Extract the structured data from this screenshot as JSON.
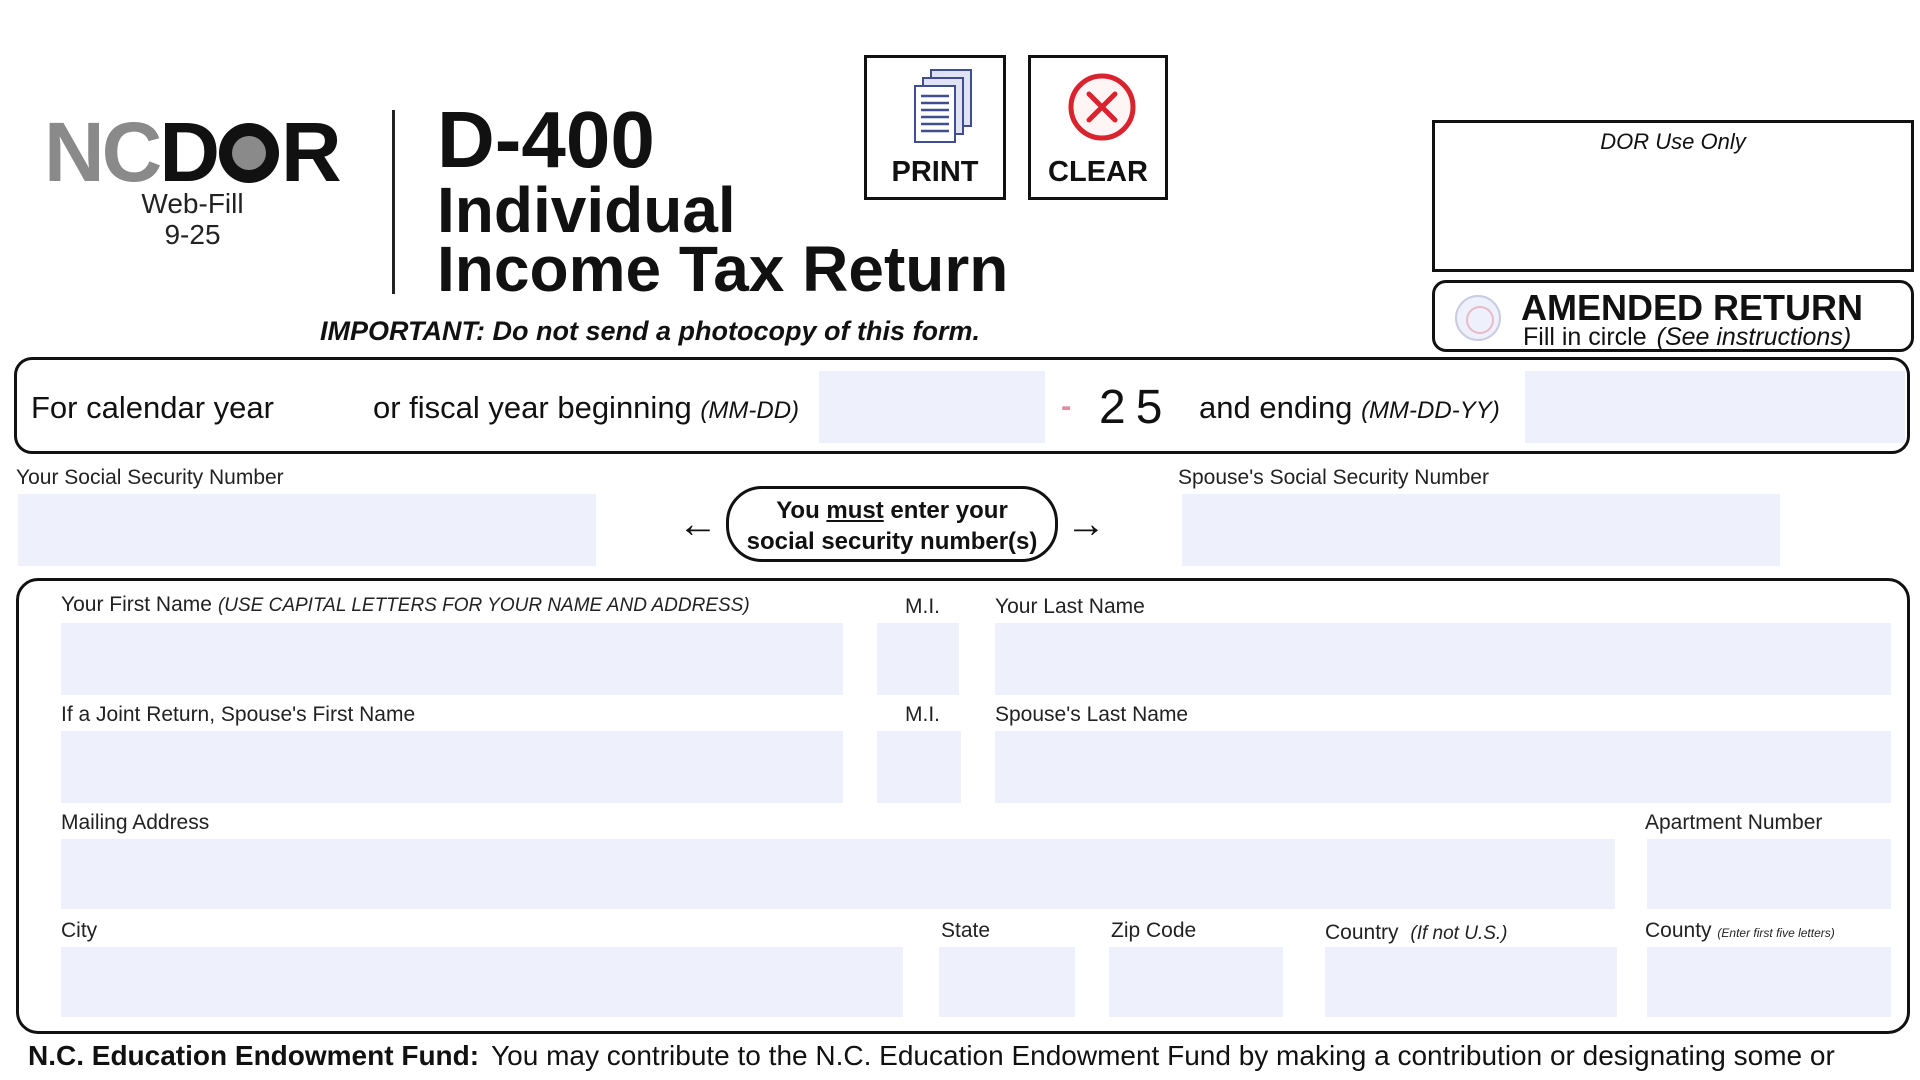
{
  "header": {
    "logo_nc": "NC",
    "logo_d": "D",
    "logo_r": "R",
    "webfill": "Web-Fill",
    "version": "9-25",
    "form_number": "D-400",
    "title_line1": "Individual",
    "title_line2": "Income Tax Return",
    "important": "IMPORTANT:  Do not send a photocopy of this form."
  },
  "buttons": {
    "print_label": "PRINT",
    "clear_label": "CLEAR"
  },
  "dor_box": {
    "label": "DOR Use Only"
  },
  "amended": {
    "title": "AMENDED RETURN",
    "sub": "Fill in circle",
    "sub_note": "(See instructions)",
    "checked": false
  },
  "year_row": {
    "calendar_label": "For calendar year",
    "fiscal_label": "or fiscal year beginning",
    "fiscal_format": "(MM-DD)",
    "beginning_value": "",
    "dash": "-",
    "year_suffix": "25",
    "ending_label": "and ending",
    "ending_format": "(MM-DD-YY)",
    "ending_value": ""
  },
  "ssn": {
    "your_label": "Your Social Security Number",
    "spouse_label": "Spouse's Social Security Number",
    "note_line1_pre": "You ",
    "note_must": "must",
    "note_line1_post": " enter your",
    "note_line2": "social security number(s)",
    "arrow_left": "←",
    "arrow_right": "→",
    "your_value": "",
    "spouse_value": ""
  },
  "name_address": {
    "first_name_label": "Your First Name",
    "caps_note": "(USE CAPITAL  LETTERS FOR YOUR NAME AND ADDRESS)",
    "mi_label": "M.I.",
    "last_name_label": "Your Last Name",
    "spouse_first_label": "If a Joint Return, Spouse's First Name",
    "spouse_mi_label": "M.I.",
    "spouse_last_label": "Spouse's Last Name",
    "mailing_label": "Mailing Address",
    "apt_label": "Apartment Number",
    "city_label": "City",
    "state_label": "State",
    "zip_label": "Zip Code",
    "country_label": "Country",
    "country_note": "(If not U.S.)",
    "county_label": "County",
    "county_note": "(Enter first five letters)"
  },
  "endowment": {
    "title": "N.C. Education Endowment Fund:",
    "text": "You may contribute to the N.C. Education Endowment Fund by making a contribution or designating some or"
  },
  "colors": {
    "field_fill": "#eef0fb",
    "border": "#111111",
    "logo_gray": "#8a8a8a",
    "clear_red": "#d9232e",
    "print_blue": "#3f4f8e"
  }
}
